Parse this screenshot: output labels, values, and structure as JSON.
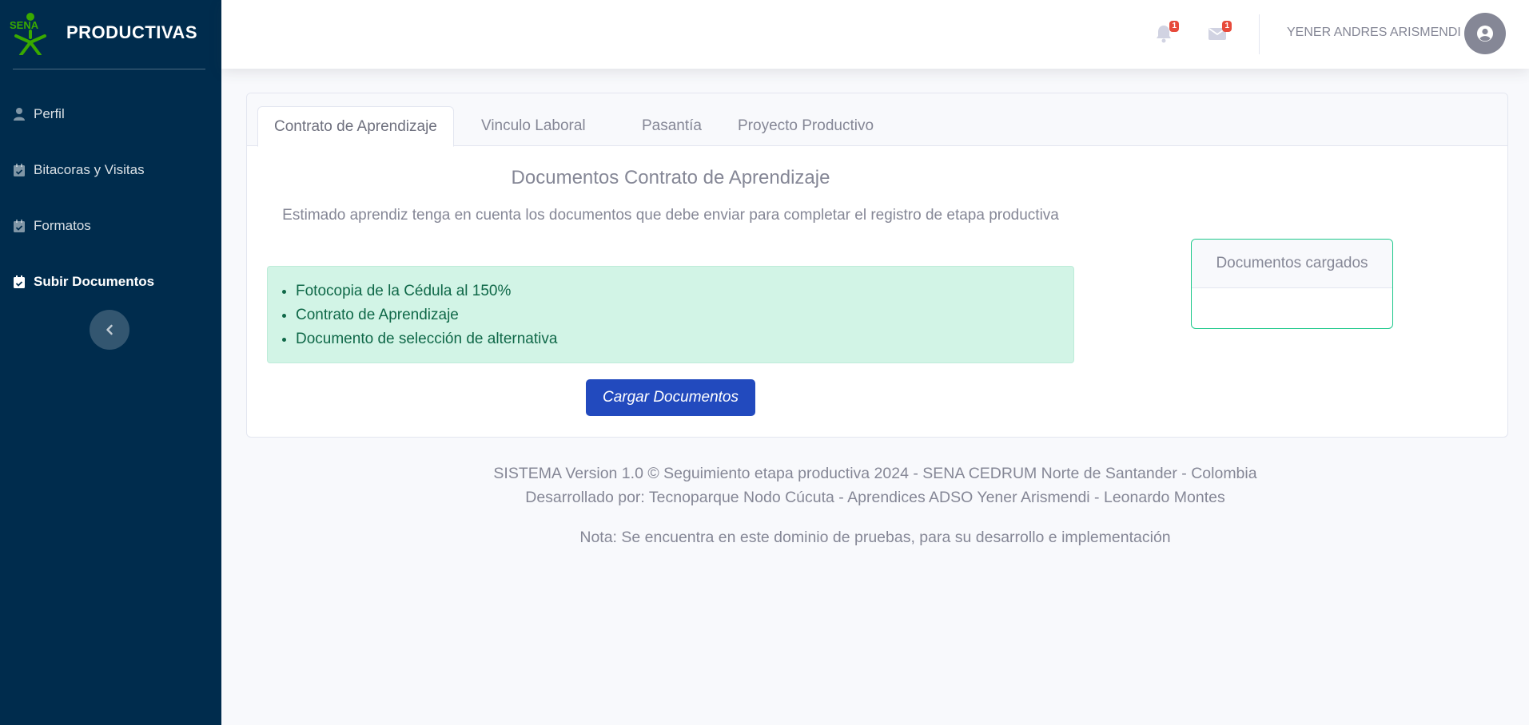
{
  "brand": {
    "logo_text": "SENA",
    "name": "PRODUCTIVAS"
  },
  "sidebar": {
    "items": [
      {
        "label": "Perfil",
        "icon": "user-icon"
      },
      {
        "label": "Bitacoras y Visitas",
        "icon": "calendar-check-icon"
      },
      {
        "label": "Formatos",
        "icon": "calendar-check-icon"
      },
      {
        "label": "Subir Documentos",
        "icon": "calendar-check-icon",
        "active": true
      }
    ],
    "toggle_icon": "chevron-left-icon"
  },
  "topbar": {
    "alerts_count": "1",
    "messages_count": "1",
    "user_name": "YENER ANDRES ARISMENDI"
  },
  "tabs": [
    {
      "label": "Contrato de Aprendizaje",
      "active": true
    },
    {
      "label": "Vinculo Laboral"
    },
    {
      "label": "Pasantía"
    },
    {
      "label": "Proyecto Productivo"
    }
  ],
  "main": {
    "title": "Documentos Contrato de Aprendizaje",
    "description": "Estimado aprendiz tenga en cuenta los documentos que debe enviar para completar el registro de etapa productiva",
    "documents": [
      "Fotocopia de la Cédula al 150%",
      "Contrato de Aprendizaje",
      "Documento de selección de alternativa"
    ],
    "load_button": "Cargar Documentos",
    "loaded_title": "Documentos cargados"
  },
  "footer": {
    "line1": "SISTEMA Version 1.0 © Seguimiento etapa productiva 2024 - SENA CEDRUM Norte de Santander - Colombia",
    "line2": "Desarrollado por: Tecnoparque Nodo Cúcuta - Aprendices ADSO Yener Arismendi - Leonardo Montes",
    "note": "Nota: Se encuentra en este dominio de pruebas, para su desarrollo e implementación"
  },
  "colors": {
    "sidebar_bg": "#002c4d",
    "primary": "#224abe",
    "success_bg": "#d2f4e6",
    "success_border": "#1cc88a",
    "badge": "#e74a3b",
    "logo_green": "#39a900"
  }
}
